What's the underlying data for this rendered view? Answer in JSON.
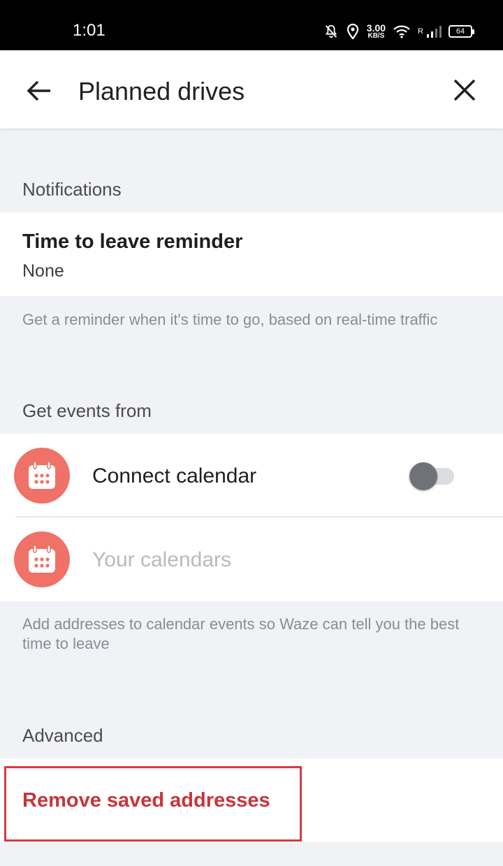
{
  "status_bar": {
    "time": "1:01",
    "net_speed_value": "3.00",
    "net_speed_unit": "KB/S",
    "roaming": "R",
    "battery": "64",
    "icons": [
      "bell-off-icon",
      "location-icon",
      "wifi-icon",
      "signal-icon",
      "battery-icon"
    ]
  },
  "header": {
    "title": "Planned drives",
    "back_icon": "arrow-left-icon",
    "close_icon": "close-icon"
  },
  "notifications": {
    "section_title": "Notifications",
    "reminder_title": "Time to leave reminder",
    "reminder_value": "None",
    "help": "Get a reminder when it's time to go, based on real-time traffic"
  },
  "events": {
    "section_title": "Get events from",
    "connect_label": "Connect calendar",
    "connect_enabled": false,
    "calendars_label": "Your calendars",
    "calendar_icon": "calendar-icon",
    "help": "Add addresses to calendar events so Waze can tell you the best time to leave"
  },
  "advanced": {
    "section_title": "Advanced",
    "remove_label": "Remove saved addresses"
  },
  "colors": {
    "accent_red": "#c8343b",
    "icon_coral": "#f07167",
    "background": "#f1f2f6",
    "highlight_border": "#d73a42"
  }
}
